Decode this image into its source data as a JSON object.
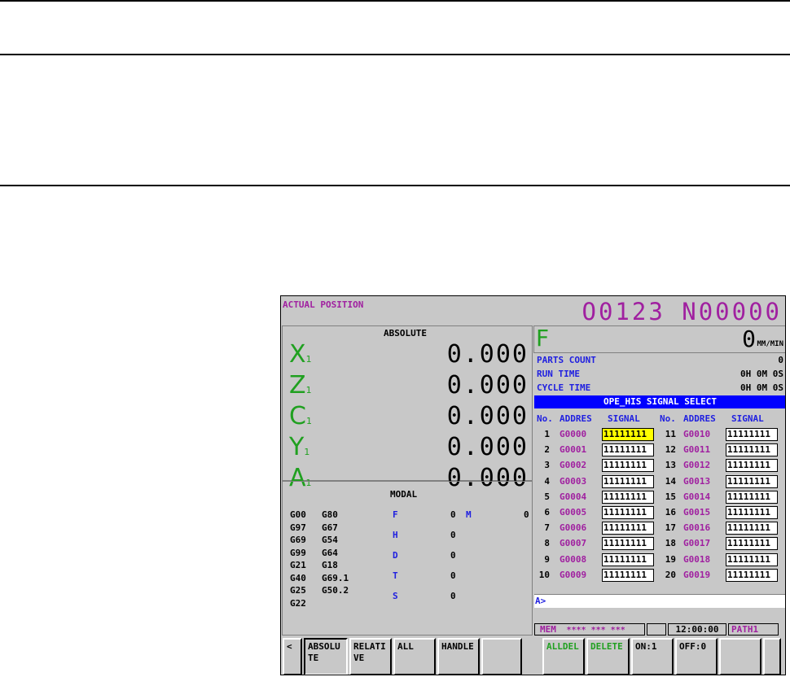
{
  "screen": {
    "title": "ACTUAL POSITION",
    "program": "O0123 N00000",
    "absolute_header": "ABSOLUTE",
    "axes": [
      {
        "name": "X",
        "sub": "1",
        "value": "0.000"
      },
      {
        "name": "Z",
        "sub": "1",
        "value": "0.000"
      },
      {
        "name": "C",
        "sub": "1",
        "value": "0.000"
      },
      {
        "name": "Y",
        "sub": "1",
        "value": "0.000"
      },
      {
        "name": "A",
        "sub": "1",
        "value": "0.000"
      }
    ],
    "feed": {
      "label": "F",
      "value": "0",
      "unit": "MM/MIN"
    },
    "counters": [
      {
        "label": "PARTS COUNT",
        "value": "0"
      },
      {
        "label": "RUN TIME",
        "value": "0H 0M 0S"
      },
      {
        "label": "CYCLE TIME",
        "value": "0H 0M 0S"
      }
    ],
    "signal_title": "OPE_HIS SIGNAL SELECT",
    "signal_headers": {
      "no": "No.",
      "addr": "ADDRES",
      "signal": "SIGNAL"
    },
    "signals_left": [
      {
        "no": "1",
        "addr": "G0000",
        "signal": "11111111"
      },
      {
        "no": "2",
        "addr": "G0001",
        "signal": "11111111"
      },
      {
        "no": "3",
        "addr": "G0002",
        "signal": "11111111"
      },
      {
        "no": "4",
        "addr": "G0003",
        "signal": "11111111"
      },
      {
        "no": "5",
        "addr": "G0004",
        "signal": "11111111"
      },
      {
        "no": "6",
        "addr": "G0005",
        "signal": "11111111"
      },
      {
        "no": "7",
        "addr": "G0006",
        "signal": "11111111"
      },
      {
        "no": "8",
        "addr": "G0007",
        "signal": "11111111"
      },
      {
        "no": "9",
        "addr": "G0008",
        "signal": "11111111"
      },
      {
        "no": "10",
        "addr": "G0009",
        "signal": "11111111"
      }
    ],
    "signals_right": [
      {
        "no": "11",
        "addr": "G0010",
        "signal": "11111111"
      },
      {
        "no": "12",
        "addr": "G0011",
        "signal": "11111111"
      },
      {
        "no": "13",
        "addr": "G0012",
        "signal": "11111111"
      },
      {
        "no": "14",
        "addr": "G0013",
        "signal": "11111111"
      },
      {
        "no": "15",
        "addr": "G0014",
        "signal": "11111111"
      },
      {
        "no": "16",
        "addr": "G0015",
        "signal": "11111111"
      },
      {
        "no": "17",
        "addr": "G0016",
        "signal": "11111111"
      },
      {
        "no": "18",
        "addr": "G0017",
        "signal": "11111111"
      },
      {
        "no": "19",
        "addr": "G0018",
        "signal": "11111111"
      },
      {
        "no": "20",
        "addr": "G0019",
        "signal": "11111111"
      }
    ],
    "modal_header": "MODAL",
    "gcodes": [
      [
        "G00",
        "G80"
      ],
      [
        "G97",
        "G67"
      ],
      [
        "G69",
        "G54"
      ],
      [
        "G99",
        "G64"
      ],
      [
        "G21",
        "G18"
      ],
      [
        "G40",
        "G69.1"
      ],
      [
        "G25",
        "G50.2"
      ],
      [
        "G22",
        ""
      ]
    ],
    "modal_values": [
      {
        "label": "F",
        "value": "0"
      },
      {
        "label": "H",
        "value": "0"
      },
      {
        "label": "D",
        "value": "0"
      },
      {
        "label": "T",
        "value": "0"
      },
      {
        "label": "S",
        "value": "0"
      }
    ],
    "modal_m": {
      "label": "M",
      "value": "0"
    },
    "input_prompt": "A>",
    "status": {
      "mode": "MEM",
      "stars": "**** *** ***",
      "time": "12:00:00",
      "path": "PATH1"
    },
    "softkeys_left": [
      "<",
      "ABSOLU TE",
      "RELATI VE",
      "ALL",
      "HANDLE",
      ""
    ],
    "softkeys_right": [
      "ALLDEL",
      "DELETE",
      "ON:1",
      "OFF:0",
      "",
      ""
    ]
  },
  "colors": {
    "purple": "#a020a0",
    "green": "#20a020",
    "blue": "#2020e0",
    "highlight": "#ffff00",
    "title_bar": "#0000ff"
  }
}
